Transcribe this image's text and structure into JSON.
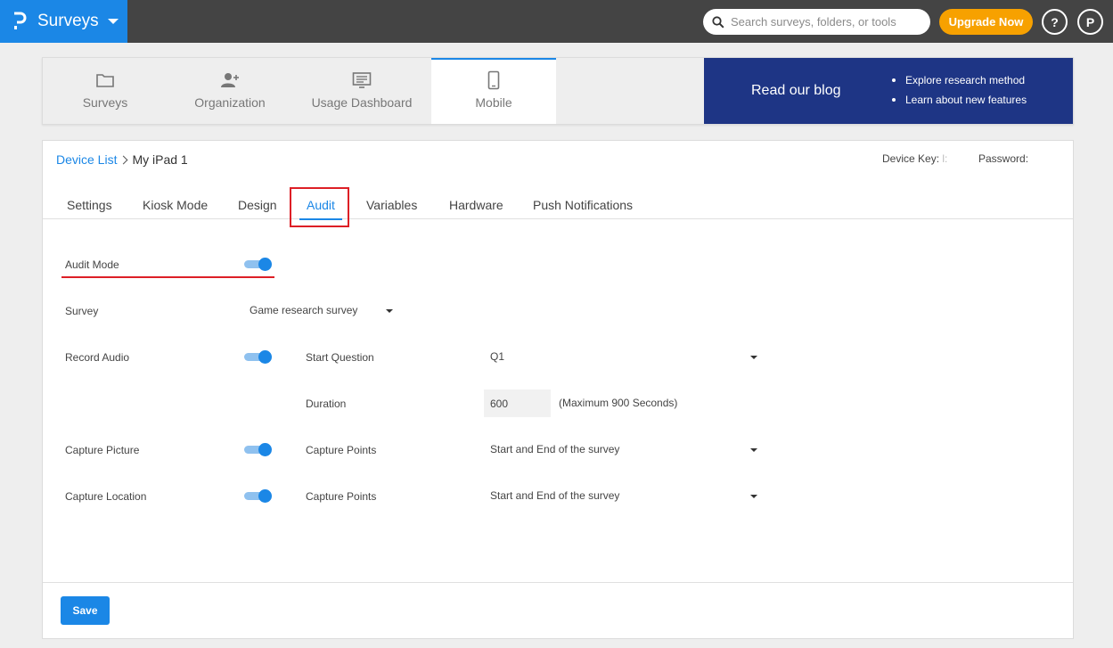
{
  "topbar": {
    "app_title": "Surveys",
    "search_placeholder": "Search surveys, folders, or tools",
    "upgrade_label": "Upgrade Now",
    "help_label": "?",
    "profile_initial": "P"
  },
  "modules": [
    {
      "label": "Surveys",
      "icon": "folder-icon"
    },
    {
      "label": "Organization",
      "icon": "add-user-icon"
    },
    {
      "label": "Usage Dashboard",
      "icon": "dashboard-icon"
    },
    {
      "label": "Mobile",
      "icon": "mobile-icon",
      "active": true
    }
  ],
  "blog": {
    "heading": "Read our blog",
    "bullets": [
      "Explore research method",
      "Learn about new features"
    ]
  },
  "breadcrumb": {
    "parent": "Device List",
    "current": "My iPad 1"
  },
  "device": {
    "key_label": "Device Key:",
    "key_value": "l:",
    "password_label": "Password:"
  },
  "tabs": [
    "Settings",
    "Kiosk Mode",
    "Design",
    "Audit",
    "Variables",
    "Hardware",
    "Push Notifications"
  ],
  "active_tab": "Audit",
  "audit": {
    "audit_mode_label": "Audit Mode",
    "audit_mode_on": true,
    "survey_label": "Survey",
    "survey_value": "Game research survey",
    "record_audio_label": "Record Audio",
    "record_audio_on": true,
    "start_question_label": "Start Question",
    "start_question_value": "Q1",
    "duration_label": "Duration",
    "duration_value": "600",
    "duration_hint": "(Maximum 900 Seconds)",
    "capture_picture_label": "Capture Picture",
    "capture_picture_on": true,
    "capture_picture_points_label": "Capture Points",
    "capture_picture_points_value": "Start and End of the survey",
    "capture_location_label": "Capture Location",
    "capture_location_on": true,
    "capture_location_points_label": "Capture Points",
    "capture_location_points_value": "Start and End of the survey"
  },
  "save_label": "Save",
  "colors": {
    "brand_blue": "#1b87e6",
    "topbar": "#444444",
    "upgrade_orange": "#f7a100",
    "blog_navy": "#1e3585",
    "highlight_red": "#dd1f26"
  }
}
